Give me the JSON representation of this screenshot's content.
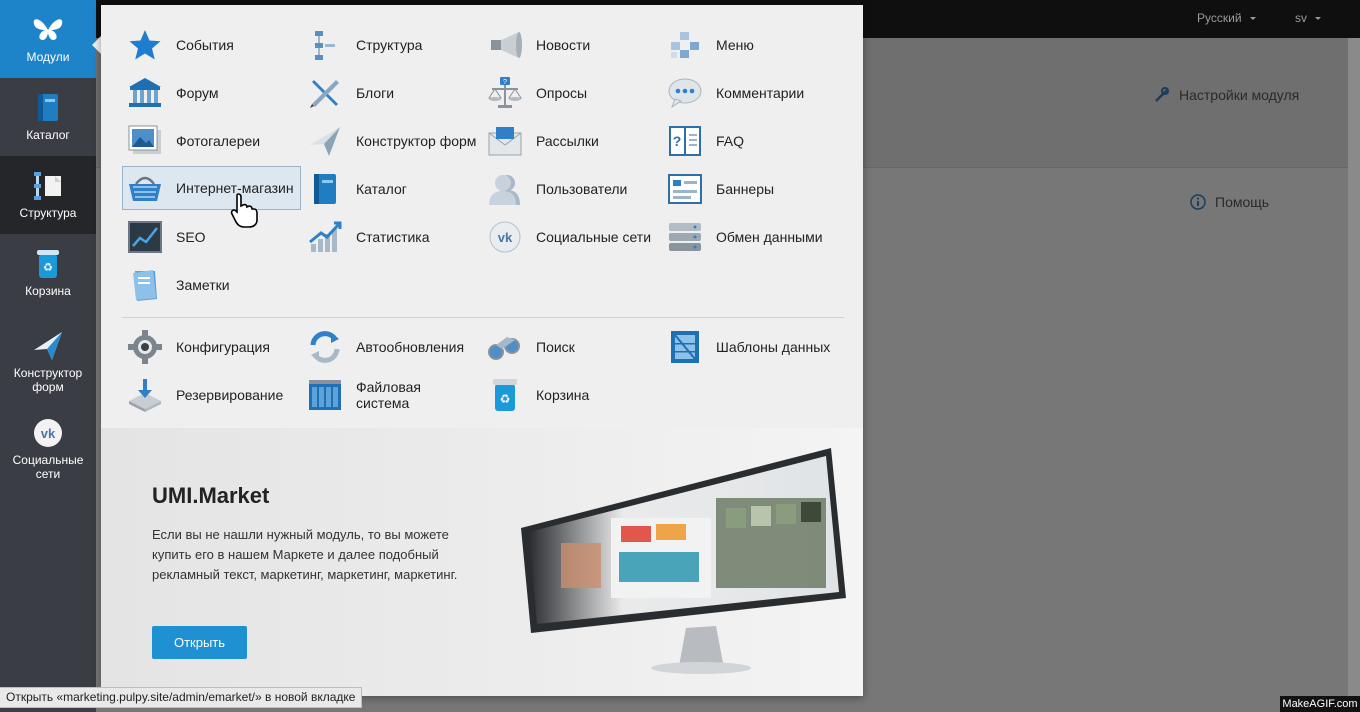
{
  "topbar": {
    "language": "Русский",
    "user": "sv"
  },
  "background_page": {
    "settings_label": "Настройки модуля",
    "help_label": "Помощь"
  },
  "sidebar": {
    "items": [
      {
        "label": "Модули",
        "icon": "butterfly-icon"
      },
      {
        "label": "Каталог",
        "icon": "book-icon"
      },
      {
        "label": "Структура",
        "icon": "structure-icon"
      },
      {
        "label": "Корзина",
        "icon": "recycle-bin-icon"
      },
      {
        "label": "Конструктор форм",
        "icon": "paper-plane-icon"
      },
      {
        "label": "Социальные сети",
        "icon": "vk-icon"
      }
    ]
  },
  "modules": {
    "main": [
      {
        "label": "События",
        "icon": "star-icon"
      },
      {
        "label": "Структура",
        "icon": "structure-icon"
      },
      {
        "label": "Новости",
        "icon": "megaphone-icon"
      },
      {
        "label": "Меню",
        "icon": "menu-blocks-icon"
      },
      {
        "label": "Форум",
        "icon": "columns-building-icon"
      },
      {
        "label": "Блоги",
        "icon": "pencil-ruler-icon"
      },
      {
        "label": "Опросы",
        "icon": "scales-icon"
      },
      {
        "label": "Комментарии",
        "icon": "speech-bubble-icon"
      },
      {
        "label": "Фотогалереи",
        "icon": "photo-gallery-icon"
      },
      {
        "label": "Конструктор форм",
        "icon": "paper-plane-icon"
      },
      {
        "label": "Рассылки",
        "icon": "envelope-icon"
      },
      {
        "label": "FAQ",
        "icon": "question-book-icon"
      },
      {
        "label": "Интернет-магазин",
        "icon": "shopping-basket-icon"
      },
      {
        "label": "Каталог",
        "icon": "book-icon"
      },
      {
        "label": "Пользователи",
        "icon": "user-icon"
      },
      {
        "label": "Баннеры",
        "icon": "banner-icon"
      },
      {
        "label": "SEO",
        "icon": "seo-chart-icon"
      },
      {
        "label": "Статистика",
        "icon": "statistics-icon"
      },
      {
        "label": "Социальные сети",
        "icon": "vk-icon"
      },
      {
        "label": "Обмен данными",
        "icon": "server-icon"
      },
      {
        "label": "Заметки",
        "icon": "notes-icon"
      }
    ],
    "system": [
      {
        "label": "Конфигурация",
        "icon": "gear-icon"
      },
      {
        "label": "Автообновления",
        "icon": "refresh-icon"
      },
      {
        "label": "Поиск",
        "icon": "binoculars-icon"
      },
      {
        "label": "Шаблоны данных",
        "icon": "template-icon"
      },
      {
        "label": "Резервирование",
        "icon": "backup-icon"
      },
      {
        "label": "Файловая система",
        "icon": "file-cabinet-icon"
      },
      {
        "label": "Корзина",
        "icon": "recycle-bin-icon"
      }
    ]
  },
  "market": {
    "title": "UMI.Market",
    "text": "Если вы не нашли нужный модуль, то вы можете купить его в нашем Маркете и далее подобный рекламный текст, маркетинг, маркетинг, маркетинг.",
    "button": "Открыть"
  },
  "status_bar": "Открыть «marketing.pulpy.site/admin/emarket/» в новой вкладке",
  "watermark": "MakeAGIF.com",
  "colors": {
    "accent": "#1e84c9",
    "button": "#1f90d2",
    "sidebar": "#3a3d43"
  }
}
